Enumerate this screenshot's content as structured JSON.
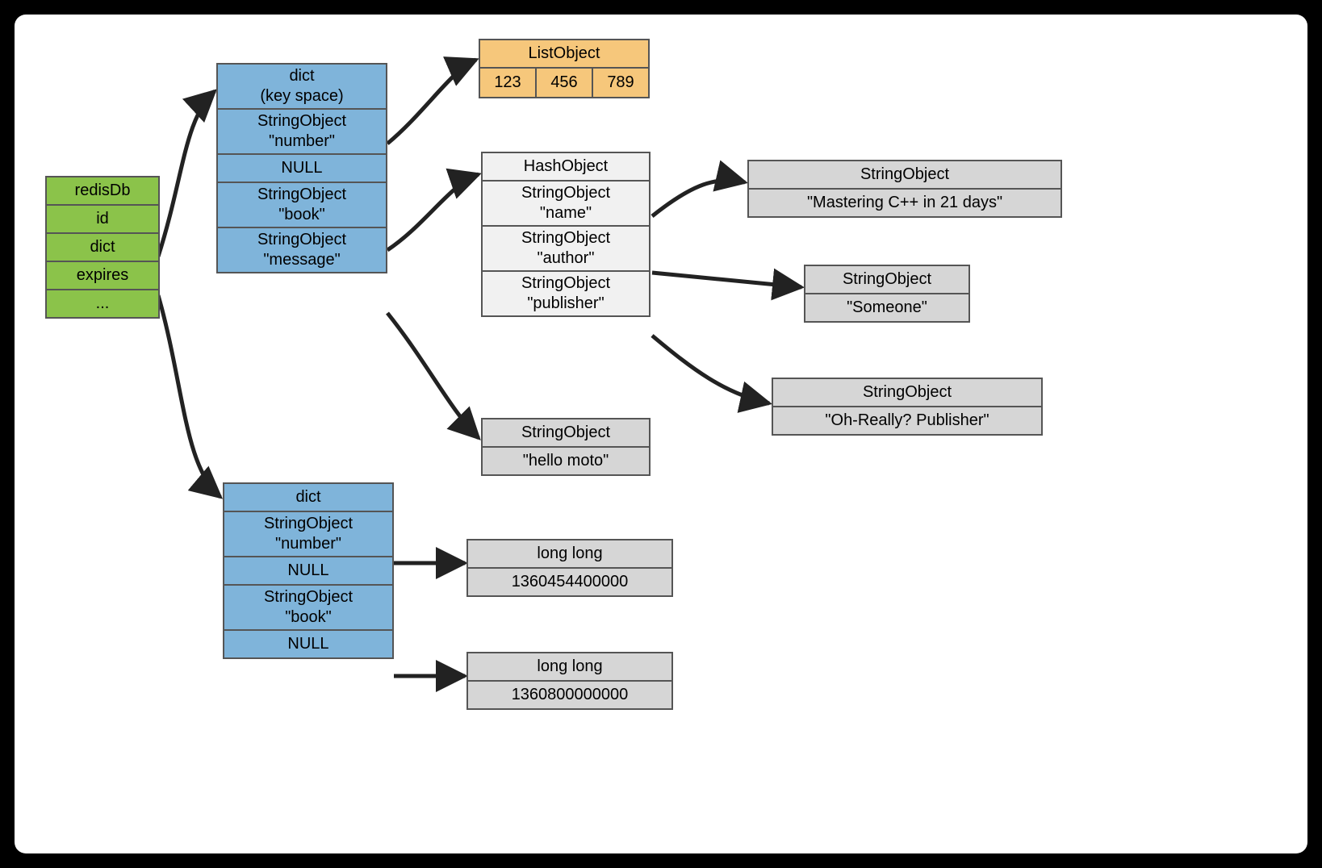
{
  "redisDb": {
    "title": "redisDb",
    "rows": [
      "id",
      "dict",
      "expires",
      "..."
    ]
  },
  "dictKeyspace": {
    "title_l1": "dict",
    "title_l2": "(key space)",
    "entries": [
      {
        "l1": "StringObject",
        "l2": "\"number\""
      },
      {
        "l1": "NULL"
      },
      {
        "l1": "StringObject",
        "l2": "\"book\""
      },
      {
        "l1": "StringObject",
        "l2": "\"message\""
      }
    ]
  },
  "listObject": {
    "title": "ListObject",
    "cells": [
      "123",
      "456",
      "789"
    ]
  },
  "hashObject": {
    "title": "HashObject",
    "fields": [
      {
        "l1": "StringObject",
        "l2": "\"name\""
      },
      {
        "l1": "StringObject",
        "l2": "\"author\""
      },
      {
        "l1": "StringObject",
        "l2": "\"publisher\""
      }
    ]
  },
  "msgValue": {
    "title": "StringObject",
    "value": "\"hello moto\""
  },
  "nameValue": {
    "title": "StringObject",
    "value": "\"Mastering C++ in 21 days\""
  },
  "authorValue": {
    "title": "StringObject",
    "value": "\"Someone\""
  },
  "publisherValue": {
    "title": "StringObject",
    "value": "\"Oh-Really? Publisher\""
  },
  "expiresDict": {
    "title": "dict",
    "entries": [
      {
        "l1": "StringObject",
        "l2": "\"number\""
      },
      {
        "l1": "NULL"
      },
      {
        "l1": "StringObject",
        "l2": "\"book\""
      },
      {
        "l1": "NULL"
      }
    ]
  },
  "expNumber": {
    "title": "long long",
    "value": "1360454400000"
  },
  "expBook": {
    "title": "long long",
    "value": "1360800000000"
  }
}
